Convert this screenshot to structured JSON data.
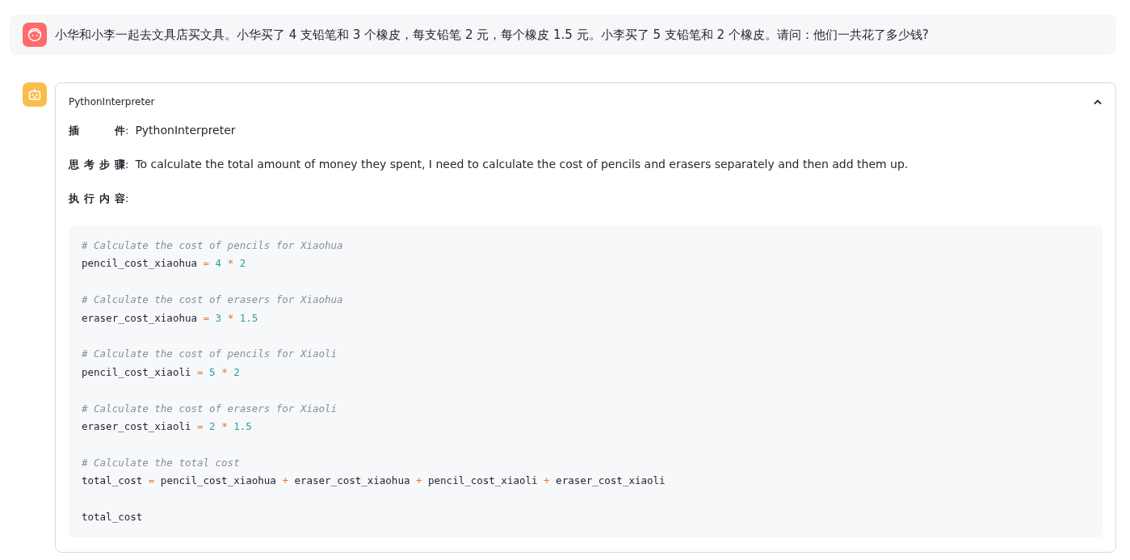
{
  "user_message": {
    "text": "小华和小李一起去文具店买文具。小华买了 4 支铅笔和 3 个橡皮，每支铅笔 2 元，每个橡皮 1.5 元。小李买了 5 支铅笔和 2 个橡皮。请问：他们一共花了多少钱?"
  },
  "tool_card": {
    "title": "PythonInterpreter",
    "expanded": true,
    "fields": [
      {
        "label": "插件",
        "separator": ":",
        "value": "PythonInterpreter"
      },
      {
        "label": "思考步骤",
        "separator": ":",
        "value": "To calculate the total amount of money they spent, I need to calculate the cost of pencils and erasers separately and then add them up."
      },
      {
        "label": "执行内容",
        "separator": ":"
      }
    ],
    "code_blocks": [
      [
        [
          {
            "kind": "comment",
            "text": "# Calculate the cost of pencils for Xiaohua"
          }
        ],
        [
          {
            "kind": "name",
            "text": "pencil_cost_xiaohua"
          },
          {
            "kind": "op",
            "text": "="
          },
          {
            "kind": "number",
            "text": "4"
          },
          {
            "kind": "op",
            "text": "*"
          },
          {
            "kind": "number",
            "text": "2"
          }
        ]
      ],
      [
        [
          {
            "kind": "comment",
            "text": "# Calculate the cost of erasers for Xiaohua"
          }
        ],
        [
          {
            "kind": "name",
            "text": "eraser_cost_xiaohua"
          },
          {
            "kind": "op",
            "text": "="
          },
          {
            "kind": "number",
            "text": "3"
          },
          {
            "kind": "op",
            "text": "*"
          },
          {
            "kind": "number",
            "text": "1.5"
          }
        ]
      ],
      [
        [
          {
            "kind": "comment",
            "text": "# Calculate the cost of pencils for Xiaoli"
          }
        ],
        [
          {
            "kind": "name",
            "text": "pencil_cost_xiaoli"
          },
          {
            "kind": "op",
            "text": "="
          },
          {
            "kind": "number",
            "text": "5"
          },
          {
            "kind": "op",
            "text": "*"
          },
          {
            "kind": "number",
            "text": "2"
          }
        ]
      ],
      [
        [
          {
            "kind": "comment",
            "text": "# Calculate the cost of erasers for Xiaoli"
          }
        ],
        [
          {
            "kind": "name",
            "text": "eraser_cost_xiaoli"
          },
          {
            "kind": "op",
            "text": "="
          },
          {
            "kind": "number",
            "text": "2"
          },
          {
            "kind": "op",
            "text": "*"
          },
          {
            "kind": "number",
            "text": "1.5"
          }
        ]
      ],
      [
        [
          {
            "kind": "comment",
            "text": "# Calculate the total cost"
          }
        ],
        [
          {
            "kind": "name",
            "text": "total_cost"
          },
          {
            "kind": "op",
            "text": "="
          },
          {
            "kind": "name",
            "text": "pencil_cost_xiaohua"
          },
          {
            "kind": "op",
            "text": "+"
          },
          {
            "kind": "name",
            "text": "eraser_cost_xiaohua"
          },
          {
            "kind": "op",
            "text": "+"
          },
          {
            "kind": "name",
            "text": "pencil_cost_xiaoli"
          },
          {
            "kind": "op",
            "text": "+"
          },
          {
            "kind": "name",
            "text": "eraser_cost_xiaoli"
          }
        ]
      ],
      [
        [
          {
            "kind": "name",
            "text": "total_cost"
          }
        ]
      ]
    ]
  }
}
